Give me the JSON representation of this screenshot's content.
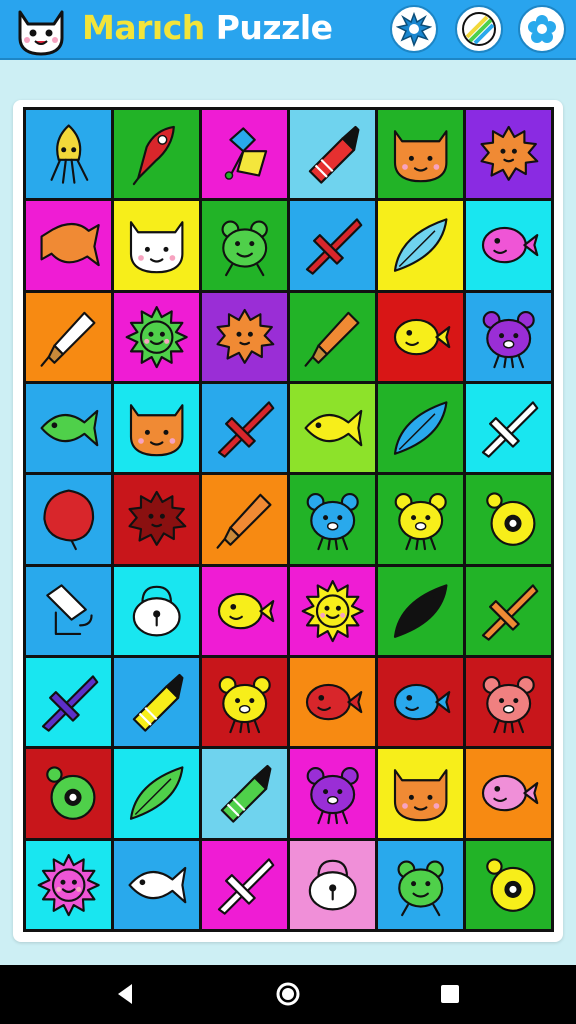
{
  "header": {
    "title_part1": "Marıch",
    "title_part2": "Puzzle",
    "logo_icon": "cat-face-icon",
    "buttons": [
      {
        "name": "splash-button",
        "icon": "splash-icon"
      },
      {
        "name": "stripes-button",
        "icon": "stripes-icon"
      },
      {
        "name": "flower-button",
        "icon": "flower-icon"
      }
    ]
  },
  "board": {
    "rows": 9,
    "cols": 6,
    "tiles": [
      [
        {
          "bg": "#29a9ec",
          "icon": "squid",
          "color": "#f2d83a"
        },
        {
          "bg": "#22b327",
          "icon": "rocket",
          "color": "#d8262b"
        },
        {
          "bg": "#ef1cd4",
          "icon": "flower-bunch",
          "color": "#f4e63c"
        },
        {
          "bg": "#6fd3ee",
          "icon": "crayon",
          "color": "#e63030"
        },
        {
          "bg": "#22b327",
          "icon": "cat-face",
          "color": "#f08a34"
        },
        {
          "bg": "#8a2be2",
          "icon": "spiky-fish",
          "color": "#f08a34"
        }
      ],
      [
        {
          "bg": "#ef1cd4",
          "icon": "candy",
          "color": "#f08a34"
        },
        {
          "bg": "#f7ee1a",
          "icon": "cat-face",
          "color": "#ffffff"
        },
        {
          "bg": "#22b327",
          "icon": "frog",
          "color": "#4fd04a"
        },
        {
          "bg": "#29a9ec",
          "icon": "plane",
          "color": "#d8262b"
        },
        {
          "bg": "#f7ee1a",
          "icon": "leaf",
          "color": "#6fd3ee"
        },
        {
          "bg": "#19e6f0",
          "icon": "blowfish",
          "color": "#ef55d6"
        }
      ],
      [
        {
          "bg": "#f78a12",
          "icon": "brush",
          "color": "#ffffff"
        },
        {
          "bg": "#ef1cd4",
          "icon": "sun",
          "color": "#4fd04a"
        },
        {
          "bg": "#9a2ed6",
          "icon": "spiky-fish",
          "color": "#f08a34"
        },
        {
          "bg": "#22b327",
          "icon": "brush",
          "color": "#f08a34"
        },
        {
          "bg": "#d81616",
          "icon": "blowfish",
          "color": "#f7ee1a"
        },
        {
          "bg": "#29a9ec",
          "icon": "bear",
          "color": "#9a2ed6"
        }
      ],
      [
        {
          "bg": "#29a9ec",
          "icon": "fish",
          "color": "#4fd04a"
        },
        {
          "bg": "#19e6f0",
          "icon": "cat-face",
          "color": "#f08a34"
        },
        {
          "bg": "#29a9ec",
          "icon": "plane",
          "color": "#d8262b"
        },
        {
          "bg": "#8de22a",
          "icon": "fish",
          "color": "#f7ee1a"
        },
        {
          "bg": "#22b327",
          "icon": "leaf",
          "color": "#29a9ec"
        },
        {
          "bg": "#19e6f0",
          "icon": "plane",
          "color": "#ffffff"
        }
      ],
      [
        {
          "bg": "#29a9ec",
          "icon": "balloon",
          "color": "#d8262b"
        },
        {
          "bg": "#c8161b",
          "icon": "spiky-fish",
          "color": "#8a1010"
        },
        {
          "bg": "#f78a12",
          "icon": "brush",
          "color": "#f08a34"
        },
        {
          "bg": "#22b327",
          "icon": "bear",
          "color": "#29a9ec"
        },
        {
          "bg": "#22b327",
          "icon": "bear",
          "color": "#f7ee1a"
        },
        {
          "bg": "#22b327",
          "icon": "donut",
          "color": "#f7ee1a"
        }
      ],
      [
        {
          "bg": "#29a9ec",
          "icon": "bag",
          "color": "#ffffff"
        },
        {
          "bg": "#19e6f0",
          "icon": "lock",
          "color": "#ffffff"
        },
        {
          "bg": "#ef1cd4",
          "icon": "blowfish",
          "color": "#f7ee1a"
        },
        {
          "bg": "#ef1cd4",
          "icon": "sun",
          "color": "#f7ee1a"
        },
        {
          "bg": "#22b327",
          "icon": "leaf",
          "color": "#111111"
        },
        {
          "bg": "#22b327",
          "icon": "plane",
          "color": "#f08a34"
        }
      ],
      [
        {
          "bg": "#19e6f0",
          "icon": "plane",
          "color": "#5b2fc8"
        },
        {
          "bg": "#29a9ec",
          "icon": "crayon",
          "color": "#f7ee1a"
        },
        {
          "bg": "#c8161b",
          "icon": "bear",
          "color": "#f7ee1a"
        },
        {
          "bg": "#f78a12",
          "icon": "blowfish",
          "color": "#d8262b"
        },
        {
          "bg": "#c8161b",
          "icon": "blowfish",
          "color": "#29a9ec"
        },
        {
          "bg": "#c8161b",
          "icon": "bear",
          "color": "#f08080"
        }
      ],
      [
        {
          "bg": "#c8161b",
          "icon": "donut",
          "color": "#4fd04a"
        },
        {
          "bg": "#19e6f0",
          "icon": "leaf",
          "color": "#4fd04a"
        },
        {
          "bg": "#6fd3ee",
          "icon": "crayon",
          "color": "#4fd04a"
        },
        {
          "bg": "#ef1cd4",
          "icon": "bear",
          "color": "#9a2ed6"
        },
        {
          "bg": "#f7ee1a",
          "icon": "cat-face",
          "color": "#f08a34"
        },
        {
          "bg": "#f78a12",
          "icon": "blowfish",
          "color": "#f08fd8"
        }
      ],
      [
        {
          "bg": "#19e6f0",
          "icon": "sun",
          "color": "#ef55d6"
        },
        {
          "bg": "#29a9ec",
          "icon": "fish",
          "color": "#ffffff"
        },
        {
          "bg": "#ef1cd4",
          "icon": "plane",
          "color": "#ffffff"
        },
        {
          "bg": "#f08fd8",
          "icon": "lock",
          "color": "#ffffff"
        },
        {
          "bg": "#29a9ec",
          "icon": "frog",
          "color": "#4fd04a"
        },
        {
          "bg": "#22b327",
          "icon": "donut",
          "color": "#f7ee1a"
        }
      ]
    ]
  },
  "navbar": {
    "buttons": [
      {
        "name": "back-button",
        "icon": "back-triangle-icon"
      },
      {
        "name": "home-button",
        "icon": "home-circle-icon"
      },
      {
        "name": "recents-button",
        "icon": "recents-square-icon"
      }
    ]
  }
}
